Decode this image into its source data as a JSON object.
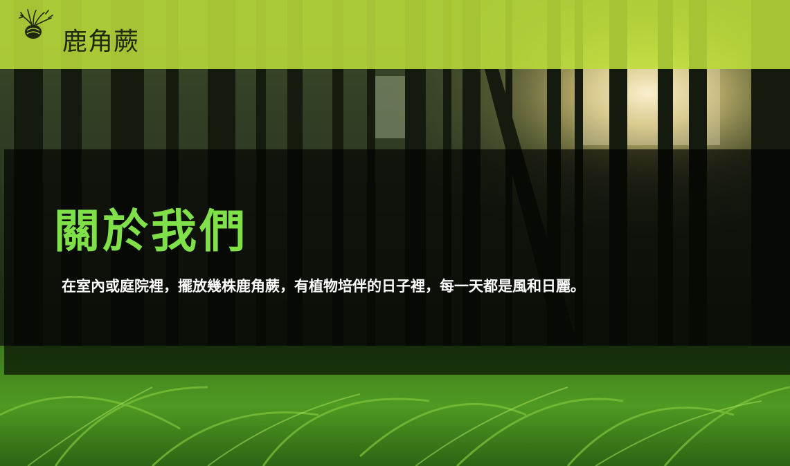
{
  "header": {
    "site_title": "鹿角蕨",
    "logo_icon": "staghorn-fern-icon",
    "background_color": "#bee03a"
  },
  "about": {
    "title": "關於我們",
    "text": "在室內或庭院裡，擺放幾株鹿角蕨，有植物培伴的日子裡，每一天都是風和日麗。",
    "title_color": "#7fe04a"
  },
  "background": {
    "image": "forest-fern-photo"
  }
}
